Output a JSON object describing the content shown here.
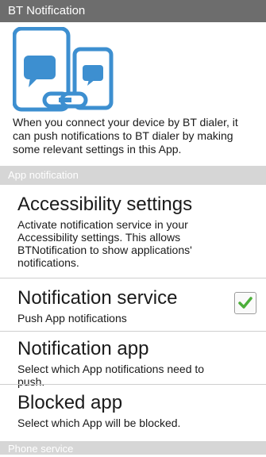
{
  "app_title": "BT Notification",
  "intro": {
    "text": "When you connect your device by BT dialer, it can push notifications to BT dialer by making some relevant settings in this App."
  },
  "sections": {
    "app_notification": "App notification",
    "phone_service": "Phone service"
  },
  "preferences": {
    "accessibility": {
      "title": "Accessibility settings",
      "summary": "Activate notification service in your Accessibility settings. This allows BTNotification to show applications' notifications."
    },
    "notification_service": {
      "title": "Notification service",
      "summary": "Push App notifications",
      "checked": true
    },
    "notification_app": {
      "title": "Notification app",
      "summary": "Select which App notifications need to push."
    },
    "blocked_app": {
      "title": "Blocked app",
      "summary": "Select which App will be blocked."
    }
  },
  "colors": {
    "title_bar": "#6d6d6d",
    "section_header": "#d6d6d6",
    "icon_blue": "#3d8fd0",
    "check_green": "#4caf3a"
  },
  "icons": {
    "hero": "phone-watch-link-icon",
    "check": "checkmark-icon"
  }
}
